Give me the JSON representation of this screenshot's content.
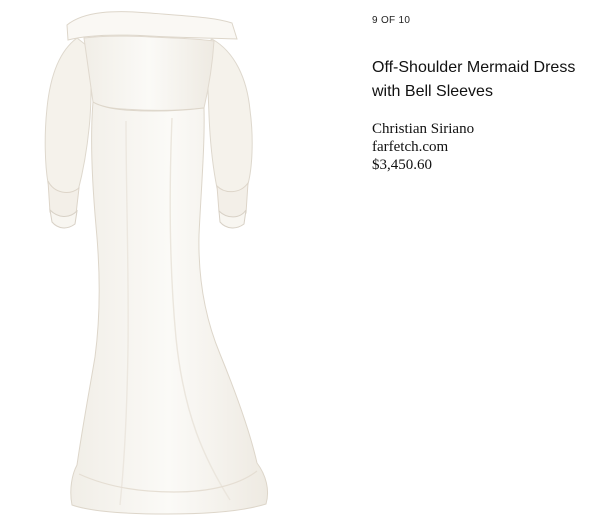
{
  "gallery": {
    "position_label": "9 OF 10"
  },
  "product": {
    "title": "Off-Shoulder Mermaid Dress with Bell Sleeves",
    "designer": "Christian Siriano",
    "retailer": "farfetch.com",
    "price": "$3,450.60",
    "image_icon": "white-gown-image"
  },
  "colors": {
    "dress": "#f7f5f0",
    "dress_shadow": "#e9e5dc",
    "background": "#ffffff",
    "text": "#111111"
  }
}
